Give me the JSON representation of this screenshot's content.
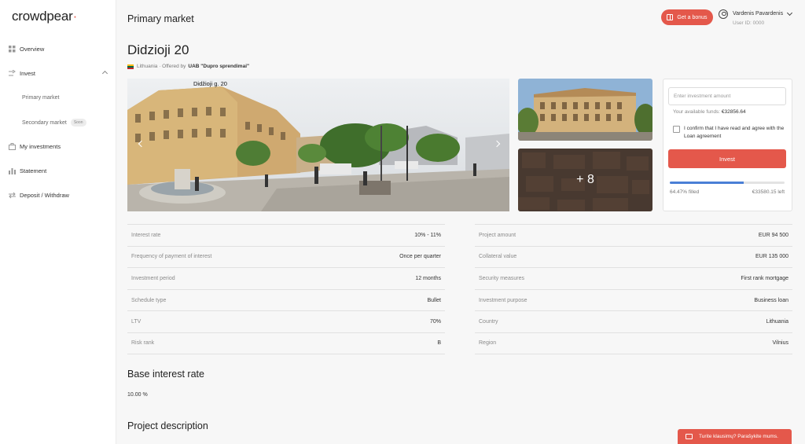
{
  "app": {
    "logo_text": "crowdpear",
    "accent": "#e4584b",
    "progress_color": "#4a7fd6"
  },
  "sidebar": {
    "items": [
      {
        "label": "Overview",
        "icon": "grid-icon"
      },
      {
        "label": "Invest",
        "icon": "invest-icon"
      },
      {
        "label": "My investments",
        "icon": "briefcase-icon"
      },
      {
        "label": "Statement",
        "icon": "bar-chart-icon"
      },
      {
        "label": "Deposit / Withdraw",
        "icon": "transfer-icon"
      }
    ],
    "subitems": [
      {
        "label": "Primary market"
      },
      {
        "label": "Secondary market",
        "badge": "Soon"
      }
    ]
  },
  "header": {
    "title": "Primary market",
    "bonus_label": "Get a bonus",
    "user_name": "Vardenis Pavardenis",
    "user_id": "User ID: 0000"
  },
  "project": {
    "title": "Didzioji 20",
    "country": "Lithuania",
    "offered_prefix": "· Offered by",
    "offered_by": "UAB \"Dupro sprendimai\"",
    "image_caption": "Didžioji g. 20",
    "more_photos": "+ 8"
  },
  "invest": {
    "amount_placeholder": "Enter investment amount",
    "funds_label": "Your available funds:",
    "funds_value": "€32856.64",
    "agree_label": "I confirm that I have read and agree with the Loan agreement",
    "invest_label": "Invest",
    "progress_percent": 64.47,
    "filled_text": "64.47% filled",
    "left_text": "€33580.15 left"
  },
  "details_left": [
    {
      "k": "Interest rate",
      "v": "10% - 11%"
    },
    {
      "k": "Frequency of payment of interest",
      "v": "Once per quarter"
    },
    {
      "k": "Investment period",
      "v": "12 months"
    },
    {
      "k": "Schedule type",
      "v": "Bullet"
    },
    {
      "k": "LTV",
      "v": "70%"
    },
    {
      "k": "Risk rank",
      "v": "B"
    }
  ],
  "details_right": [
    {
      "k": "Project amount",
      "v": "EUR 94 500"
    },
    {
      "k": "Collateral value",
      "v": "EUR 135 000"
    },
    {
      "k": "Security measures",
      "v": "First rank mortgage"
    },
    {
      "k": "Investment purpose",
      "v": "Business loan"
    },
    {
      "k": "Country",
      "v": "Lithuania"
    },
    {
      "k": "Region",
      "v": "Vilnius"
    }
  ],
  "base_rate": {
    "title": "Base interest rate",
    "value": "10.00 %"
  },
  "description": {
    "title": "Project description"
  },
  "chat": {
    "label": "Turite klausimų? Parašykite mums."
  }
}
